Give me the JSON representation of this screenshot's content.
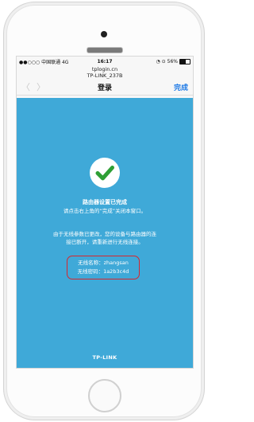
{
  "status_bar": {
    "carrier": "●●○○○ 中国联通  4G",
    "time": "16:17",
    "indicators": "◔ ⊙",
    "battery_percent": "56%",
    "battery_level": 0.56
  },
  "browser": {
    "url": "tplogin.cn",
    "ssid_title": "TP-LINK_237B"
  },
  "nav": {
    "back_icon": "chevron-left-icon",
    "forward_icon": "chevron-right-icon",
    "title": "登录",
    "done": "完成"
  },
  "content": {
    "background": "#3fa9d8",
    "success_icon": "checkmark-icon",
    "success_color": "#2e9f35",
    "title": "路由器设置已完成",
    "subtitle": "请点击右上角的“完成”关闭本窗口。",
    "info_line1": "由于无线参数已更改，您的设备与路由器的连",
    "info_line2": "接已断开，请重新进行无线连接。",
    "wifi_name": "无线名称：zhangsan",
    "wifi_password": "无线密码：1a2b3c4d",
    "brand": "TP-LINK"
  }
}
